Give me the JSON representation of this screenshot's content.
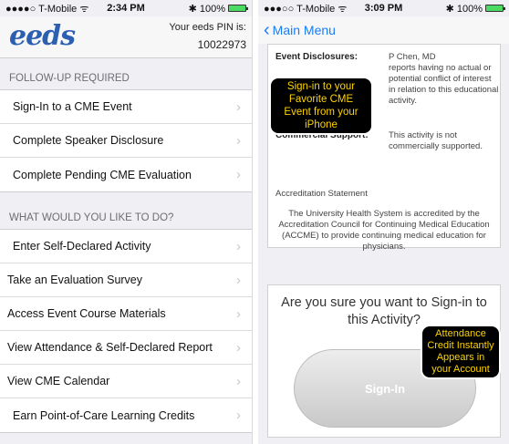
{
  "left": {
    "status": {
      "carrier": "●●●●○ T-Mobile ᯤ",
      "time": "2:34 PM",
      "battery": "✱ 100%",
      "battery_level": 1.0
    },
    "logo": "eeds",
    "pin_label": "Your eeds PIN is:",
    "pin_value": "10022973",
    "section1": "FOLLOW-UP REQUIRED",
    "followup_items": [
      "Sign-In to a CME Event",
      "Complete Speaker Disclosure",
      "Complete Pending CME Evaluation"
    ],
    "section2": "WHAT WOULD YOU LIKE TO DO?",
    "action_items": [
      "Enter Self-Declared Activity",
      "Take an Evaluation Survey",
      "Access Event Course Materials",
      "View Attendance & Self-Declared Report",
      "View CME Calendar",
      "Earn Point-of-Care Learning Credits"
    ],
    "chevron": "›"
  },
  "right": {
    "status": {
      "carrier": "●●●○○ T-Mobile ᯤ",
      "time": "3:09 PM",
      "battery": "✱ 100%",
      "battery_level": 1.0
    },
    "back_label": "Main Menu",
    "back_icon": "‹",
    "disclosures_label": "Event Disclosures:",
    "disclosures_name": "P Chen, MD",
    "disclosures_text": "reports having no actual or potential conflict of interest in relation to this educational activity.",
    "commercial_label": "Commercial Support:",
    "commercial_text": "This activity is not commercially supported.",
    "accreditation_title": "Accreditation Statement",
    "accreditation_text": "The University Health System is accredited by the Accreditation Council for Continuing Medical Education (ACCME) to provide continuing medical education for physicians.",
    "callout_top": "Sign-in to your Favorite CME Event from your iPhone",
    "confirm_question": "Are you sure you want to Sign-in to this Activity?",
    "signin_label": "Sign-In",
    "callout_bottom": "Attendance Credit Instantly Appears in your Account"
  }
}
